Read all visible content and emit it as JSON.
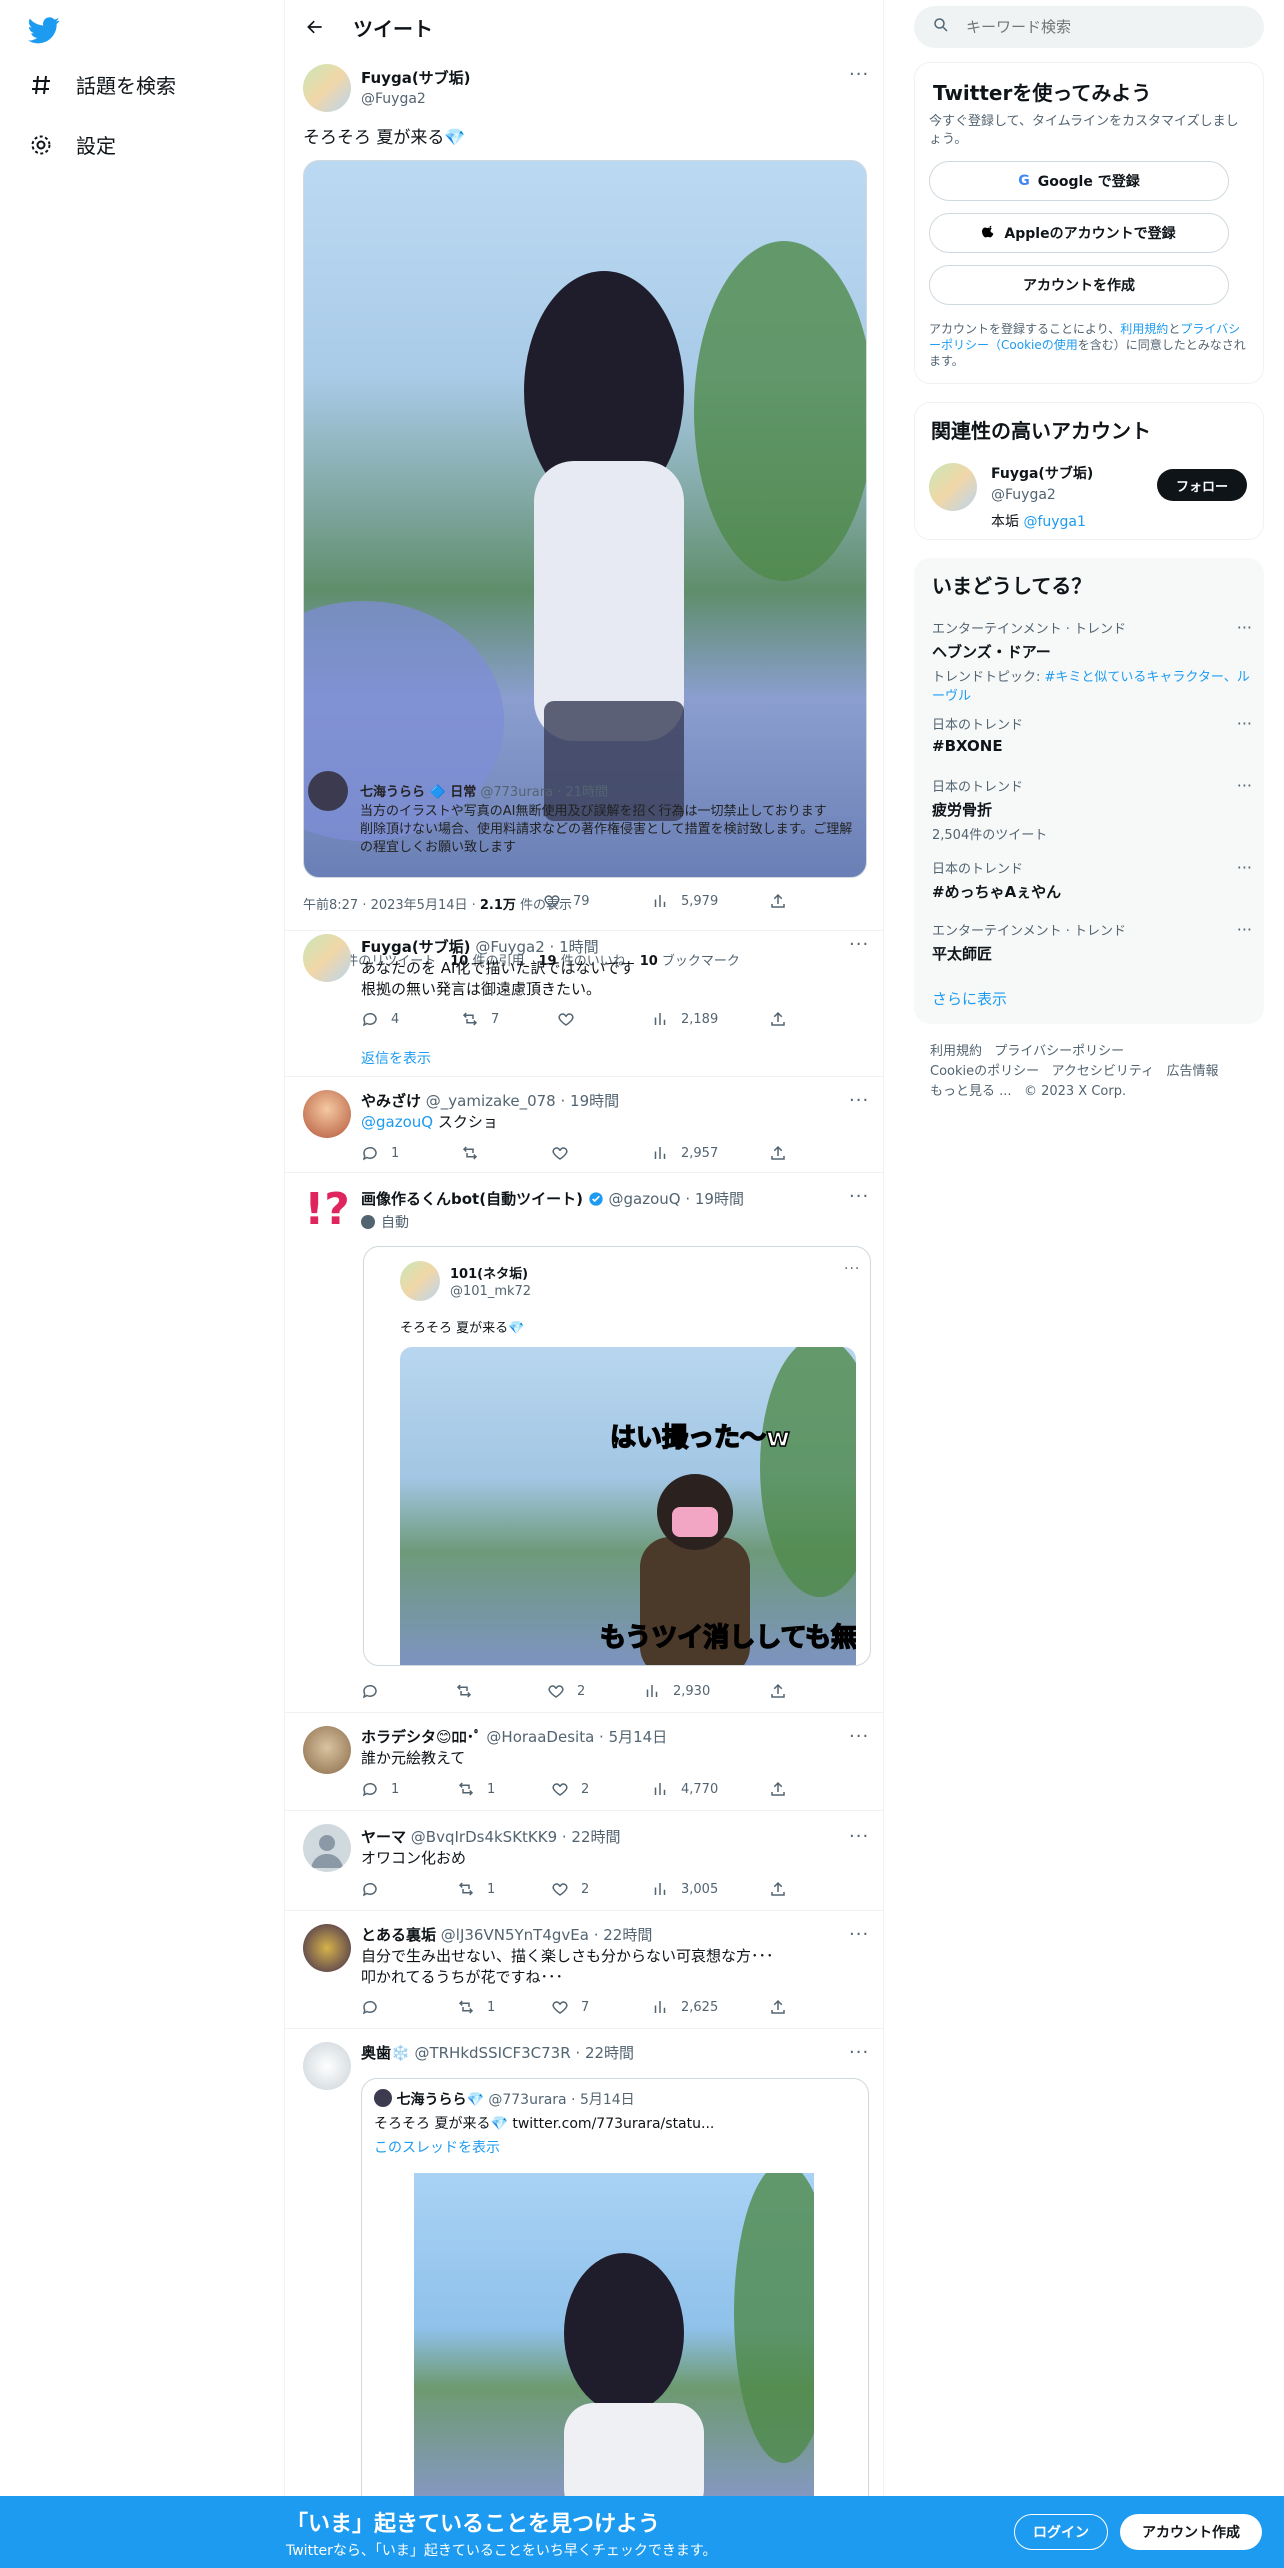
{
  "nav": {
    "explore": "話題を検索",
    "settings": "設定"
  },
  "header": {
    "title": "ツイート"
  },
  "main_tweet": {
    "name": "Fuyga(サブ垢)",
    "handle": "@Fuyga2",
    "text": "そろそろ 夏が来る💎",
    "time": "午前8:27 · 2023年5月14日 · ",
    "views_count": "2.1万",
    "views_label": " 件の表示",
    "stats": [
      {
        "count": "19",
        "label": " 件のリツイート"
      },
      {
        "count": "10",
        "label": " 件の引用"
      },
      {
        "count": "19",
        "label": " 件のいいね"
      },
      {
        "count": "10",
        "label": " ブックマーク"
      }
    ],
    "note_name": "七海うらら 🔷 日常",
    "note_meta": "@773urara · 21時間",
    "note_line1": "当方のイラストや写真のAI無断使用及び誤解を招く行為は一切禁止しております",
    "note_line2": "削除頂けない場合、使用料請求などの著作権侵害として措置を検討致します。ご理解の程宜しくお願い致します",
    "note_actions": [
      "79",
      "5,979"
    ]
  },
  "reply1": {
    "name": "Fuyga(サブ垢)",
    "handle": "@Fuyga2 · 1時間",
    "line1": "あなたのを AI化で描いた訳ではないです",
    "line2": "根拠の無い発言は御遠慮頂きたい。",
    "replies": "4",
    "retweets": "7",
    "views": "2,189",
    "show_replies": "返信を表示"
  },
  "reply2": {
    "name": "やみざけ",
    "handle": "@_yamizake_078 · 19時間",
    "mention": "@gazouQ",
    "text": " スクショ",
    "replies": "1",
    "views": "2,957"
  },
  "reply3": {
    "name": "画像作るくんbot(自動ツイート)",
    "handle": "@gazouQ · 19時間",
    "auto": "自動",
    "quote_name": "101(ネタ垢)",
    "quote_handle": "@101_mk72",
    "quote_text": "そろそろ 夏が来る💎",
    "overlay1": "はい撮った〜w",
    "overlay2": "もうツイ消ししても無駄",
    "likes": "2",
    "views": "2,930"
  },
  "reply4": {
    "name": "ホラデシタ😊ﾛﾛ･ﾟ",
    "handle": "@HoraaDesita · 5月14日",
    "text": "誰か元絵教えて",
    "replies": "1",
    "retweets": "1",
    "likes": "2",
    "views": "4,770"
  },
  "reply5": {
    "name": "ヤーマ",
    "handle": "@BvqIrDs4kSKtKK9 · 22時間",
    "text": "オワコン化おめ",
    "retweets": "1",
    "likes": "2",
    "views": "3,005"
  },
  "reply6": {
    "name": "とある裏垢",
    "handle": "@lJ36VN5YnT4gvEa · 22時間",
    "line1": "自分で生み出せない、描く楽しさも分からない可哀想な方･･･",
    "line2": "叩かれてるうちが花ですね･･･",
    "retweets": "1",
    "likes": "7",
    "views": "2,625"
  },
  "reply7": {
    "name": "奥歯❄️",
    "handle": "@TRHkdSSICF3C73R · 22時間",
    "quote_name": "七海うらら💎",
    "quote_handle": "@773urara · 5月14日",
    "quote_text": "そろそろ 夏が来る💎  twitter.com/773urara/statu...",
    "thread": "このスレッドを表示"
  },
  "sidebar": {
    "search_placeholder": "キーワード検索",
    "join_title": "Twitterを使ってみよう",
    "join_sub": "今すぐ登録して、タイムラインをカスタマイズしましょう。",
    "google_btn": "Google で登録",
    "apple_btn": "Appleのアカウントで登録",
    "create_btn": "アカウントを作成",
    "terms_a": "アカウントを登録することにより、",
    "terms_link1": "利用規約",
    "terms_b": "と",
    "terms_link2": "プライバシーポリシー（Cookieの使用",
    "terms_c": "を含む）に同意したとみなされます。",
    "related_title": "関連性の高いアカウント",
    "related_name": "Fuyga(サブ垢)",
    "related_handle": "@Fuyga2",
    "related_bio_a": "本垢 ",
    "related_bio_link": "@fuyga1",
    "follow": "フォロー",
    "trends_title": "いまどうしてる？",
    "trends": [
      {
        "cat": "エンターテインメント · トレンド",
        "title": "ヘブンズ・ドアー",
        "sub_a": "トレンドトピック: ",
        "sub_link": "#キミと似ているキャラクター、ルーヴル"
      },
      {
        "cat": "日本のトレンド",
        "title": "#BXONE",
        "sub_a": "",
        "sub_link": ""
      },
      {
        "cat": "日本のトレンド",
        "title": "疲労骨折",
        "sub_a": "2,504件のツイート",
        "sub_link": ""
      },
      {
        "cat": "日本のトレンド",
        "title": "#めっちゃAぇやん",
        "sub_a": "",
        "sub_link": ""
      },
      {
        "cat": "エンターテインメント · トレンド",
        "title": "平太師匠",
        "sub_a": "",
        "sub_link": ""
      }
    ],
    "show_more": "さらに表示",
    "footer": [
      "利用規約",
      "プライバシーポリシー",
      "Cookieのポリシー",
      "アクセシビリティ",
      "広告情報",
      "もっと見る ...",
      "© 2023 X Corp."
    ]
  },
  "bottom": {
    "title": "「いま」起きていることを見つけよう",
    "sub": "Twitterなら、「いま」起きていることをいち早くチェックできます。",
    "login": "ログイン",
    "signup": "アカウント作成"
  }
}
